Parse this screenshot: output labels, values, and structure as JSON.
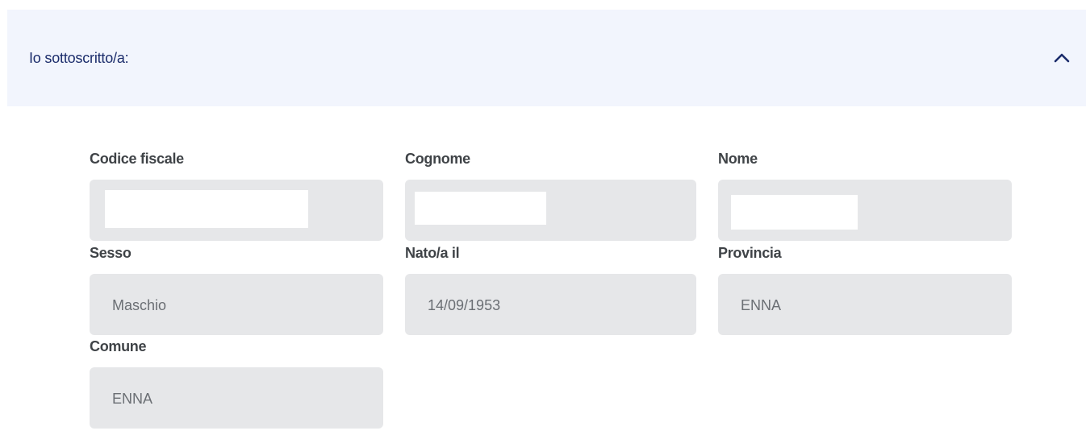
{
  "section": {
    "title": "Io sottoscritto/a:",
    "toggle_icon": "chevron-up-icon",
    "expanded": true
  },
  "fields": {
    "codice_fiscale": {
      "label": "Codice fiscale",
      "value": ""
    },
    "cognome": {
      "label": "Cognome",
      "value": ""
    },
    "nome": {
      "label": "Nome",
      "value": ""
    },
    "sesso": {
      "label": "Sesso",
      "value": "Maschio"
    },
    "nato_il": {
      "label": "Nato/a il",
      "value": "14/09/1953"
    },
    "provincia": {
      "label": "Provincia",
      "value": "ENNA"
    },
    "comune": {
      "label": "Comune",
      "value": "ENNA"
    }
  },
  "colors": {
    "header_bg": "#f2f5fd",
    "title": "#1b2c6b",
    "field_bg": "#e6e7e9",
    "label": "#3f4347",
    "value": "#6b6f74"
  }
}
